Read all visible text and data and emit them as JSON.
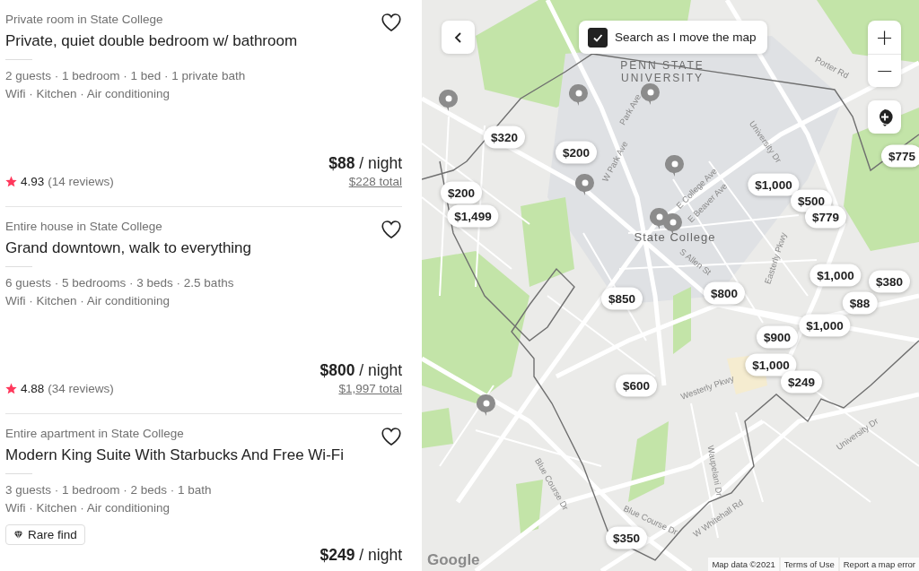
{
  "listings": [
    {
      "type": "Private room in State College",
      "title": "Private, quiet double bedroom w/ bathroom",
      "details": "2 guests · 1 bedroom · 1 bed · 1 private bath",
      "amenities": "Wifi · Kitchen · Air conditioning",
      "saved": false,
      "price": "$88",
      "price_unit": "/ night",
      "total": "$228 total",
      "rating": "4.93",
      "reviews": "(14 reviews)"
    },
    {
      "type": "Entire house in State College",
      "title": "Grand downtown, walk to everything",
      "details": "6 guests · 5 bedrooms · 3 beds · 2.5 baths",
      "amenities": "Wifi · Kitchen · Air conditioning",
      "saved": false,
      "price": "$800",
      "price_unit": "/ night",
      "total": "$1,997 total",
      "rating": "4.88",
      "reviews": "(34 reviews)"
    },
    {
      "type": "Entire apartment in State College",
      "title": "Modern King Suite With Starbucks And Free Wi-Fi",
      "details": "3 guests · 1 bedroom · 2 beds · 1 bath",
      "amenities": "Wifi · Kitchen · Air conditioning",
      "badge": "Rare find",
      "saved": false,
      "price": "$249",
      "price_unit": "/ night"
    }
  ],
  "map": {
    "search_toggle": {
      "label": "Search as I move the map",
      "checked": true
    },
    "zoom_in": "+",
    "zoom_out": "−",
    "labels": [
      "PENN STATE UNIVERSITY",
      "State College",
      "Park Ave",
      "W Park Ave",
      "E College Ave",
      "E Beaver Ave",
      "University Dr",
      "S Allen St",
      "Easterly Pkwy",
      "Porter Rd",
      "Westerly Pkwy",
      "Blue Course Dr",
      "Blue Course Dr",
      "Waupelani Dr",
      "W Whitehall Rd",
      "University Dr"
    ],
    "price_pins": [
      "$320",
      "$200",
      "$200",
      "$1,499",
      "$1,000",
      "$500",
      "$779",
      "$775",
      "$1,000",
      "$380",
      "$88",
      "$850",
      "$800",
      "$1,000",
      "$900",
      "$1,000",
      "$249",
      "$600",
      "$350"
    ],
    "logo": "Google",
    "footer": [
      "Map data ©2021",
      "Terms of Use",
      "Report a map error"
    ]
  }
}
